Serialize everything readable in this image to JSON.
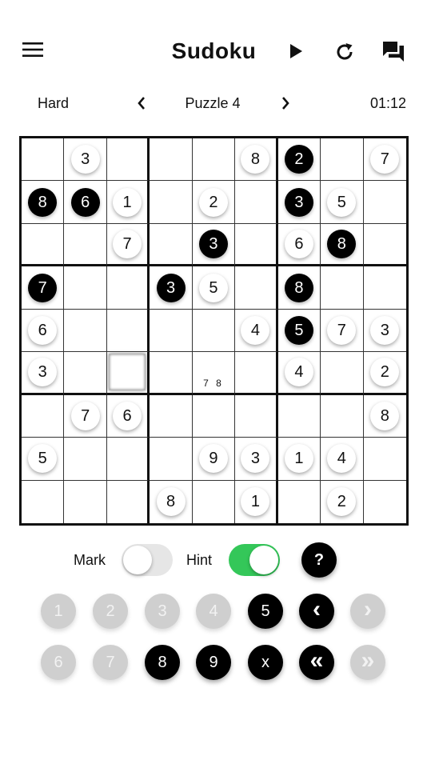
{
  "header": {
    "title": "Sudoku",
    "icons": [
      "menu-icon",
      "play-icon",
      "refresh-icon",
      "chat-icon"
    ]
  },
  "info": {
    "difficulty": "Hard",
    "puzzle": "Puzzle 4",
    "timer": "01:12"
  },
  "board": {
    "cells": [
      [
        {
          "v": ""
        },
        {
          "v": "3",
          "t": "g"
        },
        {
          "v": ""
        },
        {
          "v": ""
        },
        {
          "v": ""
        },
        {
          "v": "8",
          "t": "g"
        },
        {
          "v": "2",
          "t": "f"
        },
        {
          "v": ""
        },
        {
          "v": "7",
          "t": "g"
        }
      ],
      [
        {
          "v": "8",
          "t": "f"
        },
        {
          "v": "6",
          "t": "f"
        },
        {
          "v": "1",
          "t": "g"
        },
        {
          "v": ""
        },
        {
          "v": "2",
          "t": "g"
        },
        {
          "v": ""
        },
        {
          "v": "3",
          "t": "f"
        },
        {
          "v": "5",
          "t": "g"
        },
        {
          "v": ""
        }
      ],
      [
        {
          "v": ""
        },
        {
          "v": ""
        },
        {
          "v": "7",
          "t": "g"
        },
        {
          "v": ""
        },
        {
          "v": "3",
          "t": "f"
        },
        {
          "v": ""
        },
        {
          "v": "6",
          "t": "g"
        },
        {
          "v": "8",
          "t": "f"
        },
        {
          "v": ""
        }
      ],
      [
        {
          "v": "7",
          "t": "f"
        },
        {
          "v": ""
        },
        {
          "v": ""
        },
        {
          "v": "3",
          "t": "f"
        },
        {
          "v": "5",
          "t": "g"
        },
        {
          "v": ""
        },
        {
          "v": "8",
          "t": "f"
        },
        {
          "v": ""
        },
        {
          "v": ""
        }
      ],
      [
        {
          "v": "6",
          "t": "g"
        },
        {
          "v": ""
        },
        {
          "v": ""
        },
        {
          "v": ""
        },
        {
          "v": ""
        },
        {
          "v": "4",
          "t": "g"
        },
        {
          "v": "5",
          "t": "f"
        },
        {
          "v": "7",
          "t": "g"
        },
        {
          "v": "3",
          "t": "g"
        }
      ],
      [
        {
          "v": "3",
          "t": "g"
        },
        {
          "v": ""
        },
        {
          "v": "",
          "sel": true
        },
        {
          "v": ""
        },
        {
          "v": "",
          "notes": "7 8"
        },
        {
          "v": ""
        },
        {
          "v": "4",
          "t": "g"
        },
        {
          "v": ""
        },
        {
          "v": "2",
          "t": "g"
        }
      ],
      [
        {
          "v": ""
        },
        {
          "v": "7",
          "t": "g"
        },
        {
          "v": "6",
          "t": "g"
        },
        {
          "v": ""
        },
        {
          "v": ""
        },
        {
          "v": ""
        },
        {
          "v": ""
        },
        {
          "v": ""
        },
        {
          "v": "8",
          "t": "g"
        }
      ],
      [
        {
          "v": "5",
          "t": "g"
        },
        {
          "v": ""
        },
        {
          "v": ""
        },
        {
          "v": ""
        },
        {
          "v": "9",
          "t": "g"
        },
        {
          "v": "3",
          "t": "g"
        },
        {
          "v": "1",
          "t": "g"
        },
        {
          "v": "4",
          "t": "g"
        },
        {
          "v": ""
        }
      ],
      [
        {
          "v": ""
        },
        {
          "v": ""
        },
        {
          "v": ""
        },
        {
          "v": "8",
          "t": "g"
        },
        {
          "v": ""
        },
        {
          "v": "1",
          "t": "g"
        },
        {
          "v": ""
        },
        {
          "v": "2",
          "t": "g"
        },
        {
          "v": ""
        }
      ]
    ]
  },
  "controls": {
    "mark_label": "Mark",
    "mark_on": false,
    "hint_label": "Hint",
    "hint_on": true,
    "help_label": "?"
  },
  "keypad": {
    "row1": [
      {
        "label": "1",
        "enabled": false
      },
      {
        "label": "2",
        "enabled": false
      },
      {
        "label": "3",
        "enabled": false
      },
      {
        "label": "4",
        "enabled": false
      },
      {
        "label": "5",
        "enabled": true
      },
      {
        "label": "‹",
        "enabled": true,
        "icon": "chevron-left-icon"
      },
      {
        "label": "›",
        "enabled": false,
        "icon": "chevron-right-icon"
      }
    ],
    "row2": [
      {
        "label": "6",
        "enabled": false
      },
      {
        "label": "7",
        "enabled": false
      },
      {
        "label": "8",
        "enabled": true
      },
      {
        "label": "9",
        "enabled": true
      },
      {
        "label": "x",
        "enabled": true
      },
      {
        "label": "«",
        "enabled": true,
        "icon": "double-chevron-left-icon"
      },
      {
        "label": "»",
        "enabled": false,
        "icon": "double-chevron-right-icon"
      }
    ]
  },
  "colors": {
    "accent_toggle": "#34c759",
    "filled_disc": "#000000",
    "disabled_key": "#cfcfcf"
  }
}
